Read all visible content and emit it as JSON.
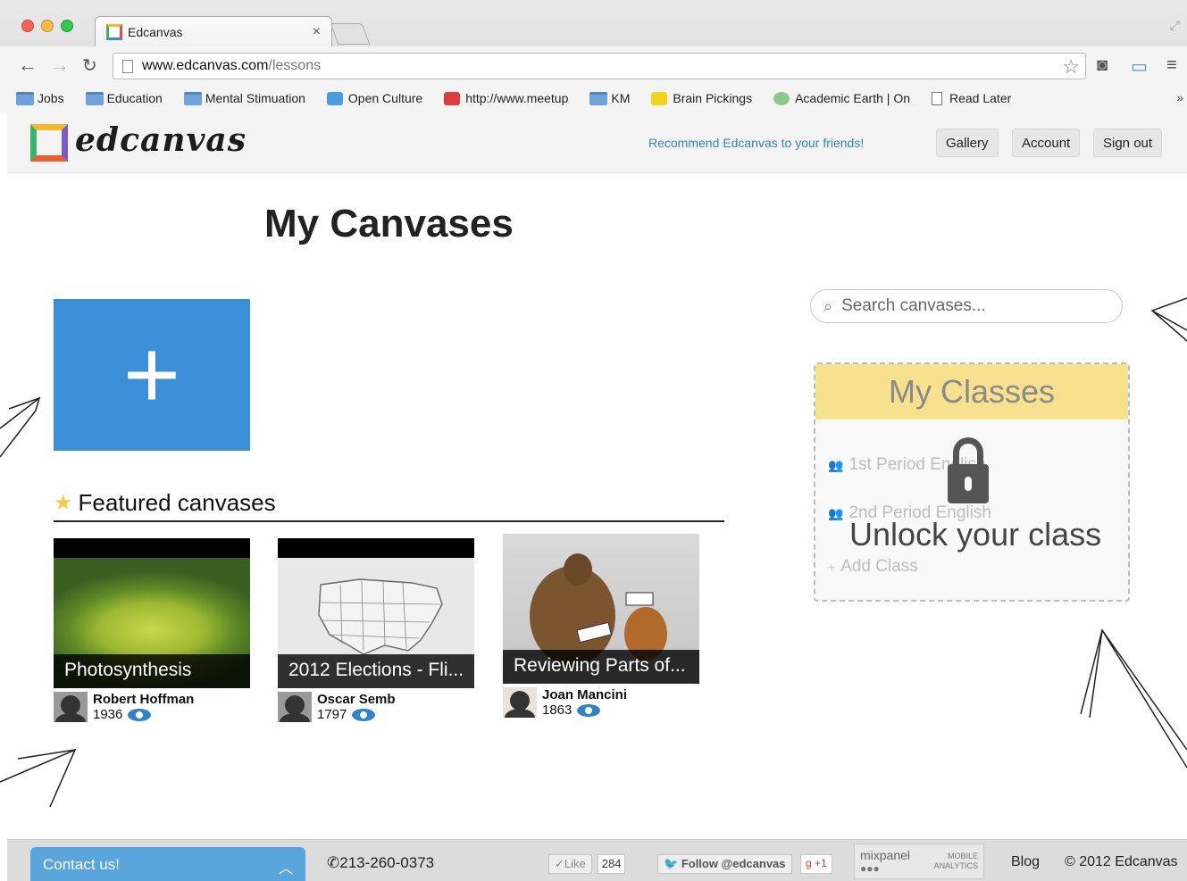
{
  "browser": {
    "tab_title": "Edcanvas",
    "tab_close": "×",
    "url_host": "www.edcanvas.com",
    "url_path": "/lessons",
    "bookmarks": [
      {
        "label": "Jobs",
        "icon": "folder-icon"
      },
      {
        "label": "Education",
        "icon": "folder-icon"
      },
      {
        "label": "Mental Stimuation",
        "icon": "folder-icon"
      },
      {
        "label": "Open Culture",
        "icon": "open-culture-icon"
      },
      {
        "label": "http://www.meetup",
        "icon": "meetup-icon"
      },
      {
        "label": "KM",
        "icon": "folder-icon"
      },
      {
        "label": "Brain Pickings",
        "icon": "brain-pickings-icon"
      },
      {
        "label": "Academic Earth | On",
        "icon": "academic-earth-icon"
      },
      {
        "label": "Read Later",
        "icon": "page-icon"
      }
    ],
    "bookmarks_more": "»"
  },
  "header": {
    "logo_text": "edcanvas",
    "recommend": "Recommend Edcanvas to your friends!",
    "gallery": "Gallery",
    "account": "Account",
    "signout": "Sign out"
  },
  "main": {
    "title": "My Canvases",
    "new_canvas_symbol": "+",
    "featured_title": "Featured canvases",
    "featured": [
      {
        "title": "Photosynthesis",
        "author": "Robert Hoffman",
        "views": "1936"
      },
      {
        "title": "2012 Elections - Fli...",
        "author": "Oscar Semb",
        "views": "1797"
      },
      {
        "title": "Reviewing Parts of...",
        "author": "Joan Mancini",
        "views": "1863"
      }
    ]
  },
  "sidebar": {
    "search_placeholder": "Search canvases...",
    "classes_title": "My Classes",
    "class_rows": [
      "1st Period English",
      "2nd Period English"
    ],
    "add_class": "Add Class",
    "unlock": "Unlock your class"
  },
  "footer": {
    "contact": "Contact us!",
    "phone": "213-260-0373",
    "like": "✓Like",
    "like_count": "284",
    "follow": "Follow @edcanvas",
    "gplus": "+1",
    "mixpanel_name": "mixpanel",
    "mixpanel_sub1": "MOBILE",
    "mixpanel_sub2": "ANALYTICS",
    "blog": "Blog",
    "copyright": "© 2012 Edcanvas"
  },
  "colors": {
    "brand_blue": "#3a8fd6",
    "link_blue": "#2f83c9",
    "classes_header": "#f7e08e"
  }
}
